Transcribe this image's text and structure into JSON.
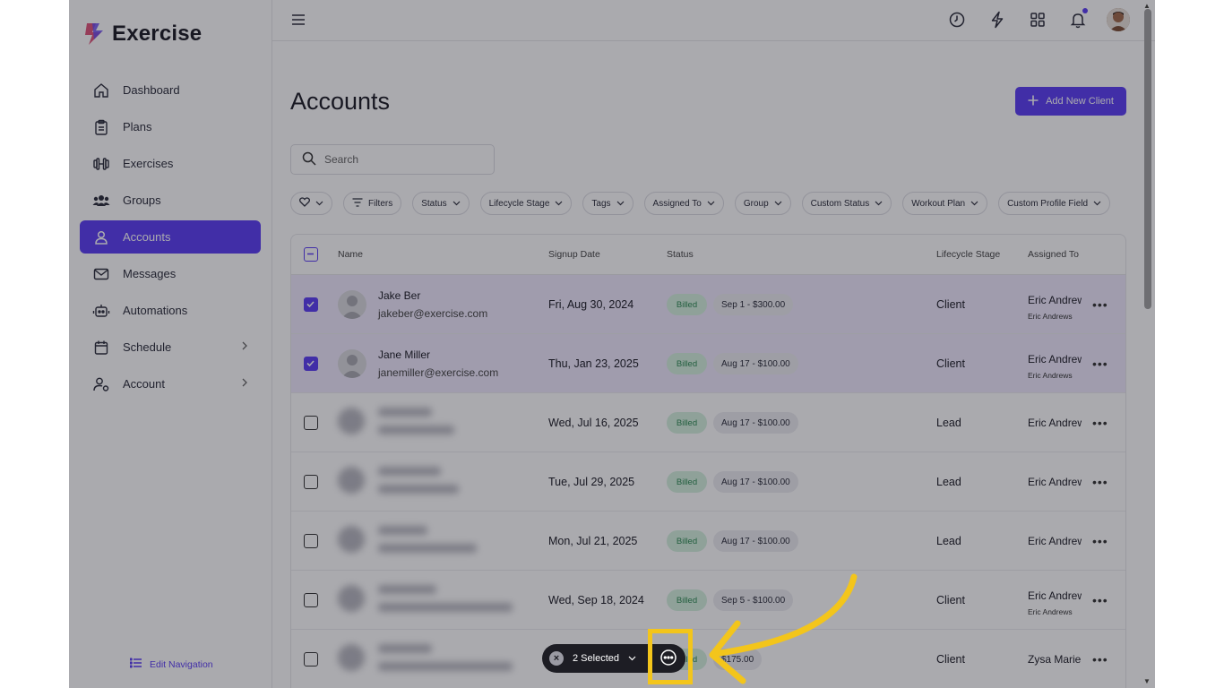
{
  "app": {
    "name": "Exercise"
  },
  "sidebar": {
    "items": [
      {
        "label": "Dashboard",
        "icon": "home-icon"
      },
      {
        "label": "Plans",
        "icon": "clipboard-icon"
      },
      {
        "label": "Exercises",
        "icon": "dumbbell-icon"
      },
      {
        "label": "Groups",
        "icon": "group-icon"
      },
      {
        "label": "Accounts",
        "icon": "user-icon",
        "active": true
      },
      {
        "label": "Messages",
        "icon": "mail-icon"
      },
      {
        "label": "Automations",
        "icon": "robot-icon"
      },
      {
        "label": "Schedule",
        "icon": "calendar-icon",
        "expandable": true
      },
      {
        "label": "Account",
        "icon": "user-settings-icon",
        "expandable": true
      }
    ],
    "edit_nav_label": "Edit Navigation"
  },
  "topbar": {
    "icons": [
      "clock-icon",
      "bolt-icon",
      "apps-grid-icon",
      "bell-icon",
      "profile-avatar"
    ]
  },
  "page": {
    "title": "Accounts",
    "add_button_label": "Add New Client",
    "search_placeholder": "Search"
  },
  "filters": [
    "Filters",
    "Status",
    "Lifecycle Stage",
    "Tags",
    "Assigned To",
    "Group",
    "Custom Status",
    "Workout Plan",
    "Custom Profile Field"
  ],
  "table": {
    "columns": {
      "name": "Name",
      "signup": "Signup Date",
      "status": "Status",
      "stage": "Lifecycle Stage",
      "assigned": "Assigned To"
    },
    "rows": [
      {
        "name": "Jake Ber",
        "email": "jakeber@exercise.com",
        "date": "Fri, Aug 30, 2024",
        "billed": "Billed",
        "plan": "Sep 1 - $300.00",
        "stage": "Client",
        "assigned": "Eric Andrews",
        "assigned_sub": "Eric Andrews",
        "checked": true
      },
      {
        "name": "Jane Miller",
        "email": "janemiller@exercise.com",
        "date": "Thu, Jan 23, 2025",
        "billed": "Billed",
        "plan": "Aug 17 - $100.00",
        "stage": "Client",
        "assigned": "Eric Andrews",
        "assigned_sub": "Eric Andrews",
        "checked": true
      },
      {
        "date": "Wed, Jul 16, 2025",
        "billed": "Billed",
        "plan": "Aug 17 - $100.00",
        "stage": "Lead",
        "assigned": "Eric Andrews",
        "checked": false
      },
      {
        "date": "Tue, Jul 29, 2025",
        "billed": "Billed",
        "plan": "Aug 17 - $100.00",
        "stage": "Lead",
        "assigned": "Eric Andrews",
        "checked": false
      },
      {
        "date": "Mon, Jul 21, 2025",
        "billed": "Billed",
        "plan": "Aug 17 - $100.00",
        "stage": "Lead",
        "assigned": "Eric Andrews",
        "checked": false
      },
      {
        "date": "Wed, Sep 18, 2024",
        "billed": "Billed",
        "plan": "Sep 5 - $100.00",
        "stage": "Client",
        "assigned": "Eric Andrews",
        "assigned_sub": "Eric Andrews",
        "checked": false
      },
      {
        "billed": "Billed",
        "plan": "$175.00",
        "stage": "Client",
        "assigned": "Zysa Marie",
        "checked": false
      }
    ]
  },
  "selection_bar": {
    "label": "2 Selected"
  },
  "colors": {
    "accent": "#5b3df5",
    "highlight": "#f3c51b",
    "billed_bg": "#d5f1df"
  }
}
